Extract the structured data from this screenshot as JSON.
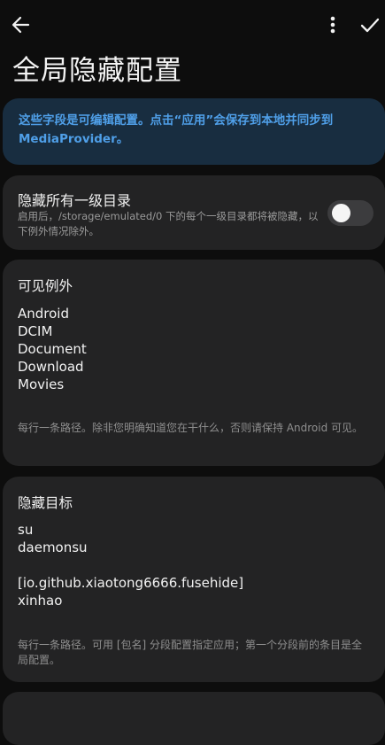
{
  "page": {
    "title": "全局隐藏配置"
  },
  "info_banner": {
    "text_line1": "这些字段是可编辑配置。点击“应用”会保存到本地并同步到",
    "text_line2": "MediaProvider。"
  },
  "hide_all_toggle": {
    "label": "隐藏所有一级目录",
    "description": "启用后，/storage/emulated/0 下的每个一级目录都将被隐藏，以下例外情况除外。",
    "enabled": false
  },
  "visible_exceptions": {
    "label": "可见例外",
    "lines": [
      "Android",
      "DCIM",
      "Document",
      "Download",
      "Movies"
    ],
    "hint": "每行一条路径。除非您明确知道您在干什么，否则请保持 Android 可见。"
  },
  "hidden_targets": {
    "label": "隐藏目标",
    "lines": [
      "su",
      "daemonsu",
      "",
      "[io.github.xiaotong6666.fusehide]",
      "xinhao"
    ],
    "hint": "每行一条路径。可用 [包名] 分段配置指定应用；第一个分段前的条目是全局配置。"
  },
  "icons": {
    "back": "arrow-left-icon",
    "more": "more-vert-icon",
    "apply": "check-icon"
  },
  "colors": {
    "background": "#0d0d0d",
    "card": "#232324",
    "info_bg": "#182d40",
    "info_text": "#4f9fe8"
  }
}
